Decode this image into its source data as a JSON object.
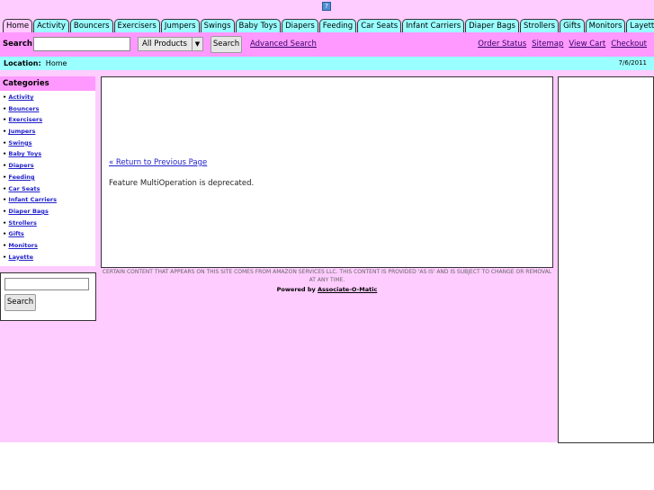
{
  "tabs": [
    "Home",
    "Activity",
    "Bouncers",
    "Exercisers",
    "Jumpers",
    "Swings",
    "Baby Toys",
    "Diapers",
    "Feeding",
    "Car Seats",
    "Infant Carriers",
    "Diaper Bags",
    "Strollers",
    "Gifts",
    "Monitors",
    "Layette"
  ],
  "search": {
    "label": "Search",
    "value": "",
    "select": "All Products",
    "button": "Search",
    "advanced": "Advanced Search"
  },
  "links": [
    "Order Status",
    "Sitemap",
    "View Cart",
    "Checkout"
  ],
  "location": {
    "label": "Location:",
    "value": "Home",
    "date": "7/6/2011"
  },
  "categories": {
    "title": "Categories",
    "items": [
      "Activity",
      "Bouncers",
      "Exercisers",
      "Jumpers",
      "Swings",
      "Baby Toys",
      "Diapers",
      "Feeding",
      "Car Seats",
      "Infant Carriers",
      "Diaper Bags",
      "Strollers",
      "Gifts",
      "Monitors",
      "Layette"
    ]
  },
  "sidebar_search": {
    "value": "",
    "button": "Search"
  },
  "main": {
    "return_link": "« Return to Previous Page",
    "message": "Feature MultiOperation is deprecated."
  },
  "footer": {
    "disclaimer": "CERTAIN CONTENT THAT APPEARS ON THIS SITE COMES FROM AMAZON SERVICES LLC. THIS CONTENT IS PROVIDED 'AS IS' AND IS SUBJECT TO CHANGE OR REMOVAL AT ANY TIME.",
    "powered_by": "Powered by",
    "powered_link": "Associate-O-Matic"
  }
}
